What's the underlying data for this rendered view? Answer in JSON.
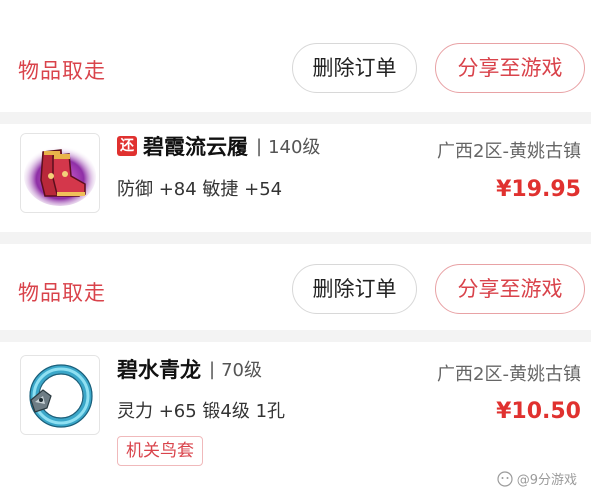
{
  "orders": [
    {
      "status": "物品取走",
      "delete_label": "删除订单",
      "share_label": "分享至游戏",
      "item": {
        "tag": "还",
        "name": "碧霞流云履",
        "level": "140级",
        "stats": "防御 +84 敏捷 +54",
        "server": "广西2区-黄姚古镇",
        "price": "¥19.95",
        "icon": "boots-icon"
      }
    },
    {
      "status": "物品取走",
      "delete_label": "删除订单",
      "share_label": "分享至游戏",
      "item": {
        "name": "碧水青龙",
        "level": "70级",
        "stats": "灵力 +65 锻4级 1孔",
        "server": "广西2区-黄姚古镇",
        "price": "¥10.50",
        "chip": "机关鸟套",
        "icon": "dragon-bracelet-icon"
      }
    }
  ],
  "separator": "|",
  "watermark": "@9分游戏",
  "colors": {
    "accent": "#d9434b",
    "price": "#e0312f",
    "divider": "#f3f3f3"
  }
}
